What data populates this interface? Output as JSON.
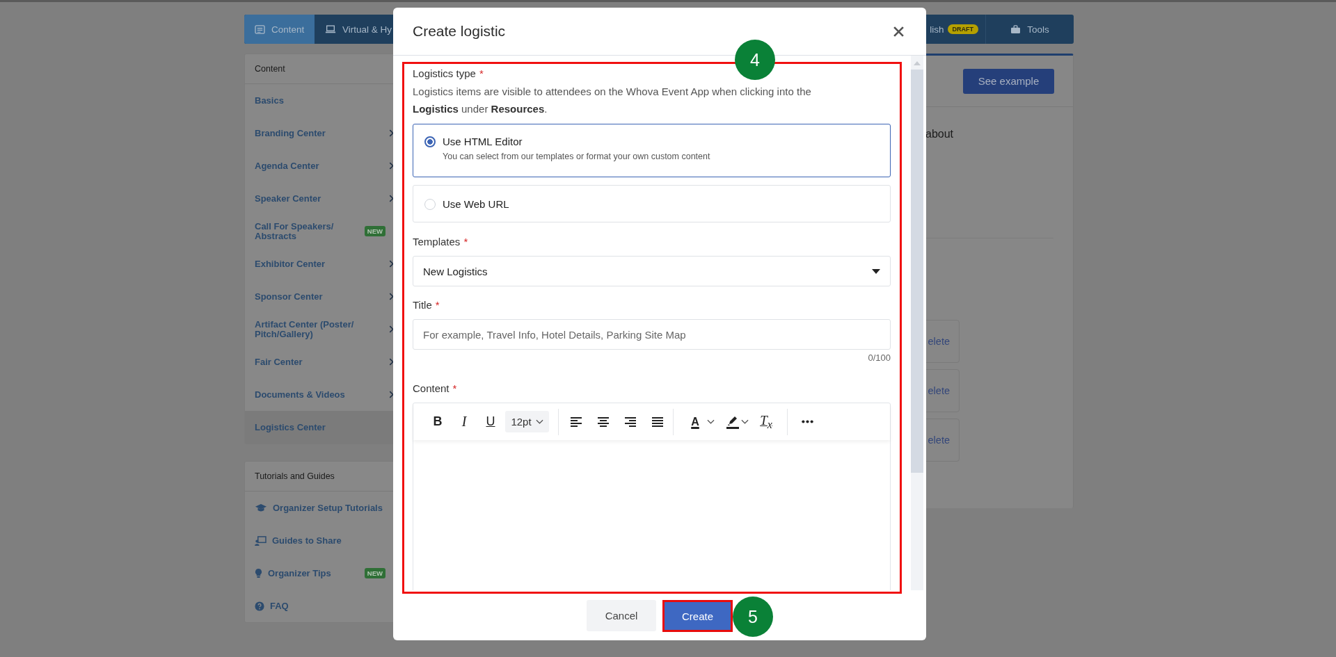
{
  "tabs_left": [
    {
      "label": "Content",
      "selected": true
    },
    {
      "label": "Virtual & Hy",
      "selected": false
    }
  ],
  "tabs_right": [
    {
      "label": "lish",
      "badge": "DRAFT",
      "selected": false
    },
    {
      "label": "Tools",
      "selected": false
    }
  ],
  "sidebar": [
    {
      "title": "Content",
      "items": [
        {
          "label": "Basics",
          "expandable": false,
          "selected": false
        },
        {
          "label": "Branding Center",
          "expandable": true,
          "selected": false
        },
        {
          "label": "Agenda Center",
          "expandable": true,
          "selected": false
        },
        {
          "label": "Speaker Center",
          "expandable": true,
          "selected": false
        },
        {
          "label": "Call For Speakers/ Abstracts",
          "badge": "NEW",
          "expandable": false,
          "selected": false
        },
        {
          "label": "Exhibitor Center",
          "expandable": true,
          "selected": false
        },
        {
          "label": "Sponsor Center",
          "expandable": true,
          "selected": false
        },
        {
          "label": "Artifact Center (Poster/ Pitch/Gallery)",
          "expandable": true,
          "selected": false
        },
        {
          "label": "Fair Center",
          "expandable": true,
          "selected": false
        },
        {
          "label": "Documents & Videos",
          "expandable": true,
          "selected": false
        },
        {
          "label": "Logistics Center",
          "expandable": false,
          "selected": true
        }
      ]
    },
    {
      "title": "Tutorials and Guides",
      "items": [
        {
          "label": "Organizer Setup Tutorials",
          "expandable": false,
          "selected": false
        },
        {
          "label": "Guides to Share",
          "expandable": false,
          "selected": false
        },
        {
          "label": "Organizer Tips",
          "badge": "NEW",
          "expandable": false,
          "selected": false
        },
        {
          "label": "FAQ",
          "expandable": false,
          "selected": false
        }
      ]
    }
  ],
  "main": {
    "see_example_button": "See example",
    "text_fragment": "about",
    "rows": [
      {
        "action": "elete"
      },
      {
        "action": "elete"
      },
      {
        "action": "elete"
      }
    ]
  },
  "modal": {
    "title": "Create logistic",
    "logistics_type": {
      "label": "Logistics type",
      "required_mark": "*",
      "description": "Logistics items are visible to attendees on the Whova Event App when clicking into the **Logistics** under **Resources**.",
      "options": [
        {
          "label": "Use HTML Editor",
          "hint": "You can select from our templates or format your own custom content",
          "selected": true
        },
        {
          "label": "Use Web URL",
          "selected": false
        }
      ]
    },
    "templates": {
      "label": "Templates",
      "required_mark": "*",
      "value": "New Logistics"
    },
    "title_field": {
      "label": "Title",
      "required_mark": "*",
      "placeholder": "For example, Travel Info, Hotel Details, Parking Site Map",
      "counter": "0/100"
    },
    "content": {
      "label": "Content",
      "required_mark": "*",
      "toolbar": {
        "bold": "B",
        "italic": "I",
        "underline": "U",
        "font_size": "12pt",
        "text_color": "A",
        "clear_format": "T$_{x}$"
      }
    },
    "buttons": {
      "cancel": "Cancel",
      "create": "Create"
    }
  },
  "step_markers": [
    "4",
    "5"
  ]
}
